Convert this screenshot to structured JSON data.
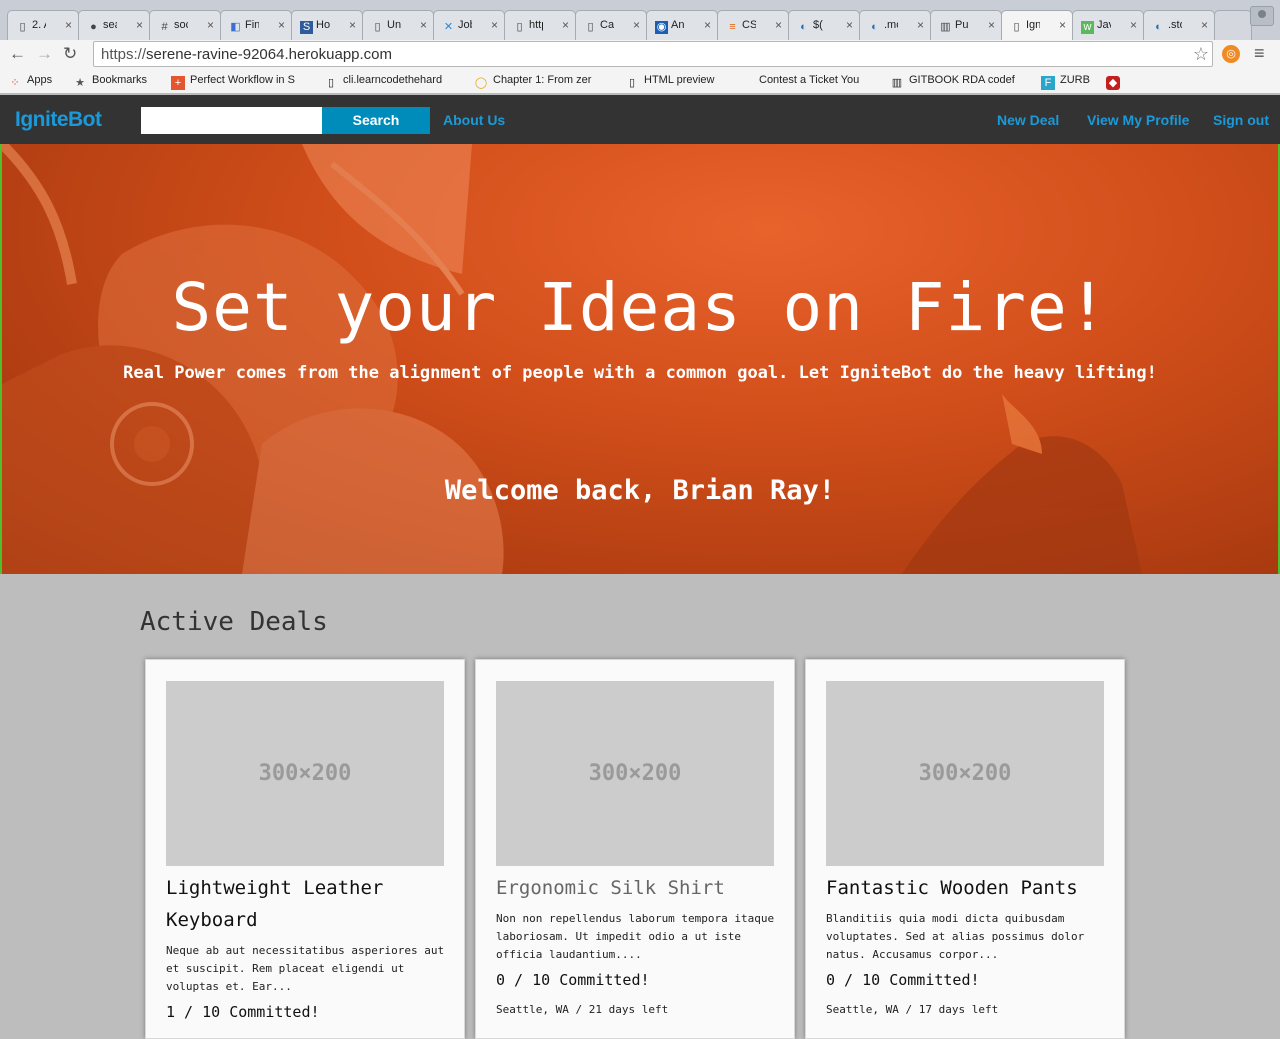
{
  "browser": {
    "tabs": [
      {
        "label": "2. A",
        "icon": "page-icon"
      },
      {
        "label": "sea",
        "icon": "github-icon"
      },
      {
        "label": "soc",
        "icon": "hash-icon"
      },
      {
        "label": "Fin",
        "icon": "finder-icon"
      },
      {
        "label": "How",
        "icon": "s-icon"
      },
      {
        "label": "Unt",
        "icon": "page-icon"
      },
      {
        "label": "Job",
        "icon": "x-icon"
      },
      {
        "label": "http",
        "icon": "page-icon"
      },
      {
        "label": "Cas",
        "icon": "page-icon"
      },
      {
        "label": "Ani",
        "icon": "ani-icon"
      },
      {
        "label": "CSS",
        "icon": "stack-icon"
      },
      {
        "label": "$(",
        "icon": "jquery-icon"
      },
      {
        "label": ".mo",
        "icon": "jquery-icon"
      },
      {
        "label": "Pur",
        "icon": "book-icon"
      },
      {
        "label": "Ign",
        "icon": "page-icon"
      },
      {
        "label": "Java",
        "icon": "w3-icon"
      },
      {
        "label": ".sto",
        "icon": "jquery-icon"
      }
    ],
    "url_scheme": "https://",
    "url_host": "serene-ravine-92064.herokuapp.com",
    "bookmarks": [
      {
        "label": "Apps",
        "icon": "apps-icon"
      },
      {
        "label": "Bookmarks",
        "icon": "star-icon"
      },
      {
        "label": "Perfect Workflow in S",
        "icon": "plus-icon"
      },
      {
        "label": "cli.learncodethehard",
        "icon": "page-icon"
      },
      {
        "label": "Chapter 1: From zer",
        "icon": "circle-icon"
      },
      {
        "label": "HTML preview",
        "icon": "page-icon"
      },
      {
        "label": "Contest a Ticket You",
        "icon": "none"
      },
      {
        "label": "GITBOOK RDA codef",
        "icon": "book-icon"
      },
      {
        "label": "ZURB",
        "icon": "zurb-icon"
      },
      {
        "label": "",
        "icon": "ruby-icon"
      }
    ]
  },
  "nav": {
    "brand": "IgniteBot",
    "search_button": "Search",
    "about": "About Us",
    "new_deal": "New Deal",
    "profile": "View My Profile",
    "signout": "Sign out"
  },
  "hero": {
    "title": "Set your Ideas on Fire!",
    "subtitle": "Real Power comes from the alignment of people with a common goal. Let IgniteBot do the heavy lifting!",
    "welcome": "Welcome back, Brian Ray!"
  },
  "deals": {
    "heading": "Active Deals",
    "items": [
      {
        "placeholder": "300×200",
        "title": "Lightweight Leather Keyboard",
        "description": "Neque ab aut necessitatibus asperiores aut et suscipit. Rem placeat eligendi ut voluptas et. Ear...",
        "committed": "1 / 10 Committed!",
        "meta": ""
      },
      {
        "placeholder": "300×200",
        "title": "Ergonomic Silk Shirt",
        "description": "Non non repellendus laborum tempora itaque laboriosam. Ut impedit odio a ut iste officia laudantium....",
        "committed": "0 / 10 Committed!",
        "meta": "Seattle, WA / 21 days left"
      },
      {
        "placeholder": "300×200",
        "title": "Fantastic Wooden Pants",
        "description": "Blanditiis quia modi dicta quibusdam voluptates. Sed at alias possimus dolor natus. Accusamus corpor...",
        "committed": "0 / 10 Committed!",
        "meta": "Seattle, WA / 17 days left"
      }
    ]
  },
  "colors": {
    "accent": "#1b9ad9",
    "search_button": "#008cba",
    "navbar": "#333333",
    "hero": "#d14e1a"
  }
}
